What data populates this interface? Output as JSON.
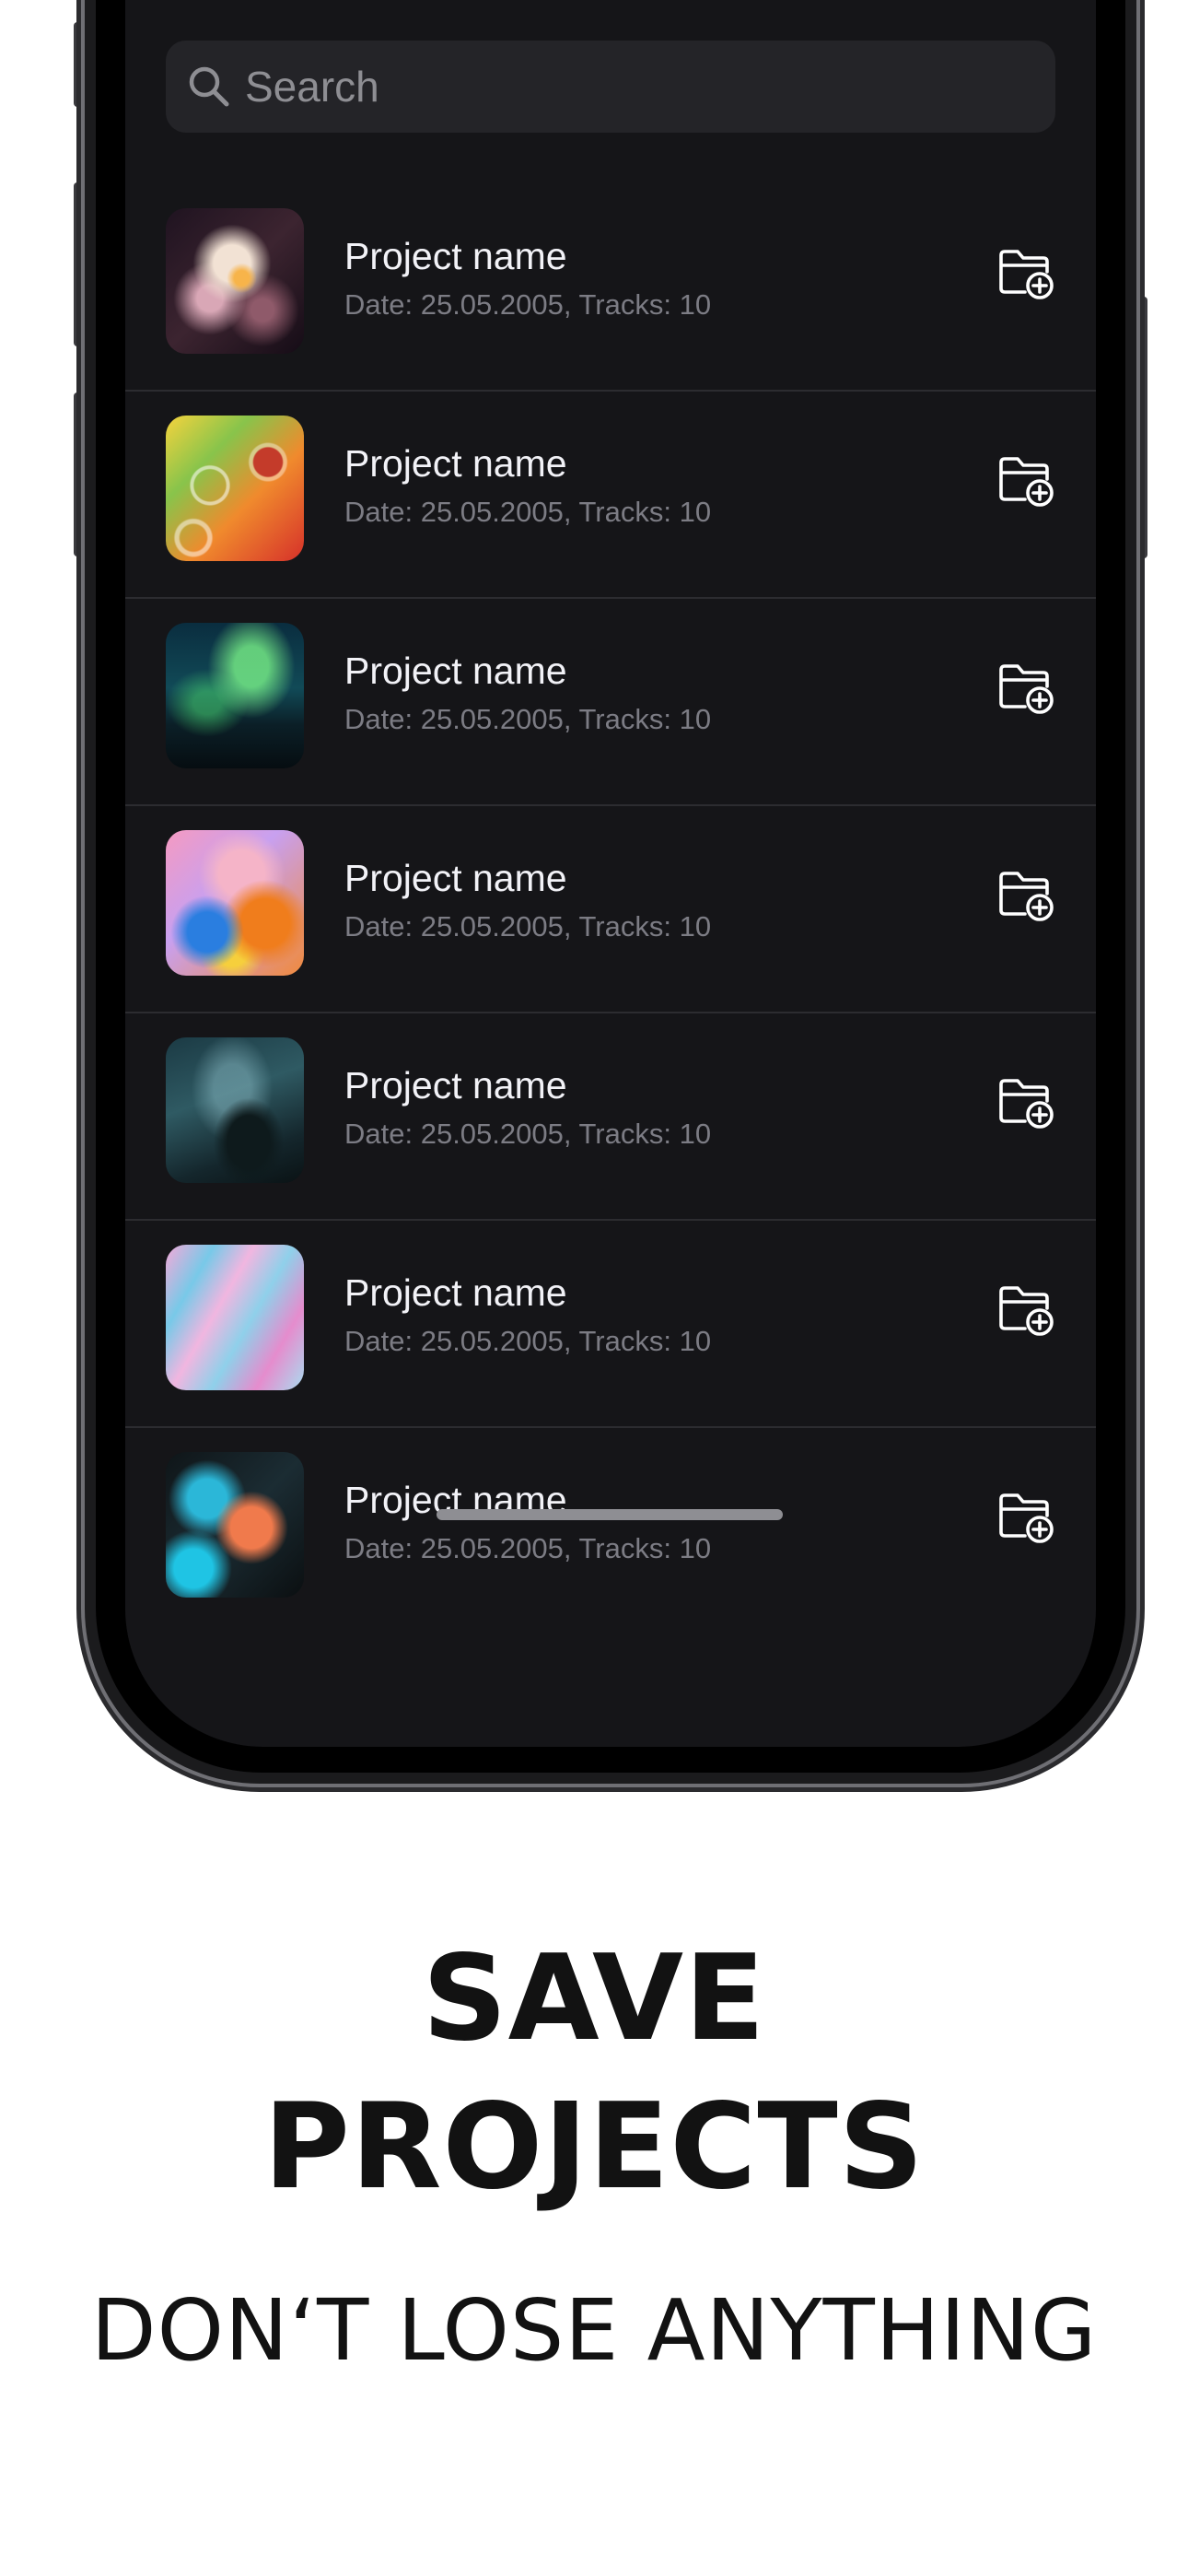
{
  "search": {
    "placeholder": "Search"
  },
  "projects": [
    {
      "name": "Project name",
      "meta": "Date: 25.05.2005, Tracks: 10",
      "thumbnail": "abstract-smoke-swirl"
    },
    {
      "name": "Project name",
      "meta": "Date: 25.05.2005, Tracks: 10",
      "thumbnail": "oil-bubbles-gradient"
    },
    {
      "name": "Project name",
      "meta": "Date: 25.05.2005, Tracks: 10",
      "thumbnail": "aurora-borealis"
    },
    {
      "name": "Project name",
      "meta": "Date: 25.05.2005, Tracks: 10",
      "thumbnail": "colorful-liquid-blobs"
    },
    {
      "name": "Project name",
      "meta": "Date: 25.05.2005, Tracks: 10",
      "thumbnail": "milky-way-landscape"
    },
    {
      "name": "Project name",
      "meta": "Date: 25.05.2005, Tracks: 10",
      "thumbnail": "pink-blue-marble"
    },
    {
      "name": "Project name",
      "meta": "Date: 25.05.2005, Tracks: 10",
      "thumbnail": "teal-orange-ink"
    }
  ],
  "icons": {
    "search": "magnifying-glass",
    "row_action": "folder-plus"
  },
  "marketing": {
    "headline_line1": "SAVE",
    "headline_line2": "PROJECTS",
    "tagline": "DON‘T LOSE ANYTHING"
  },
  "colors": {
    "screen_background": "#151518",
    "search_background": "#242428",
    "text_primary": "#f2f2f7",
    "text_secondary": "#7c7c84",
    "page_background": "#ffffff",
    "headline": "#121212"
  }
}
